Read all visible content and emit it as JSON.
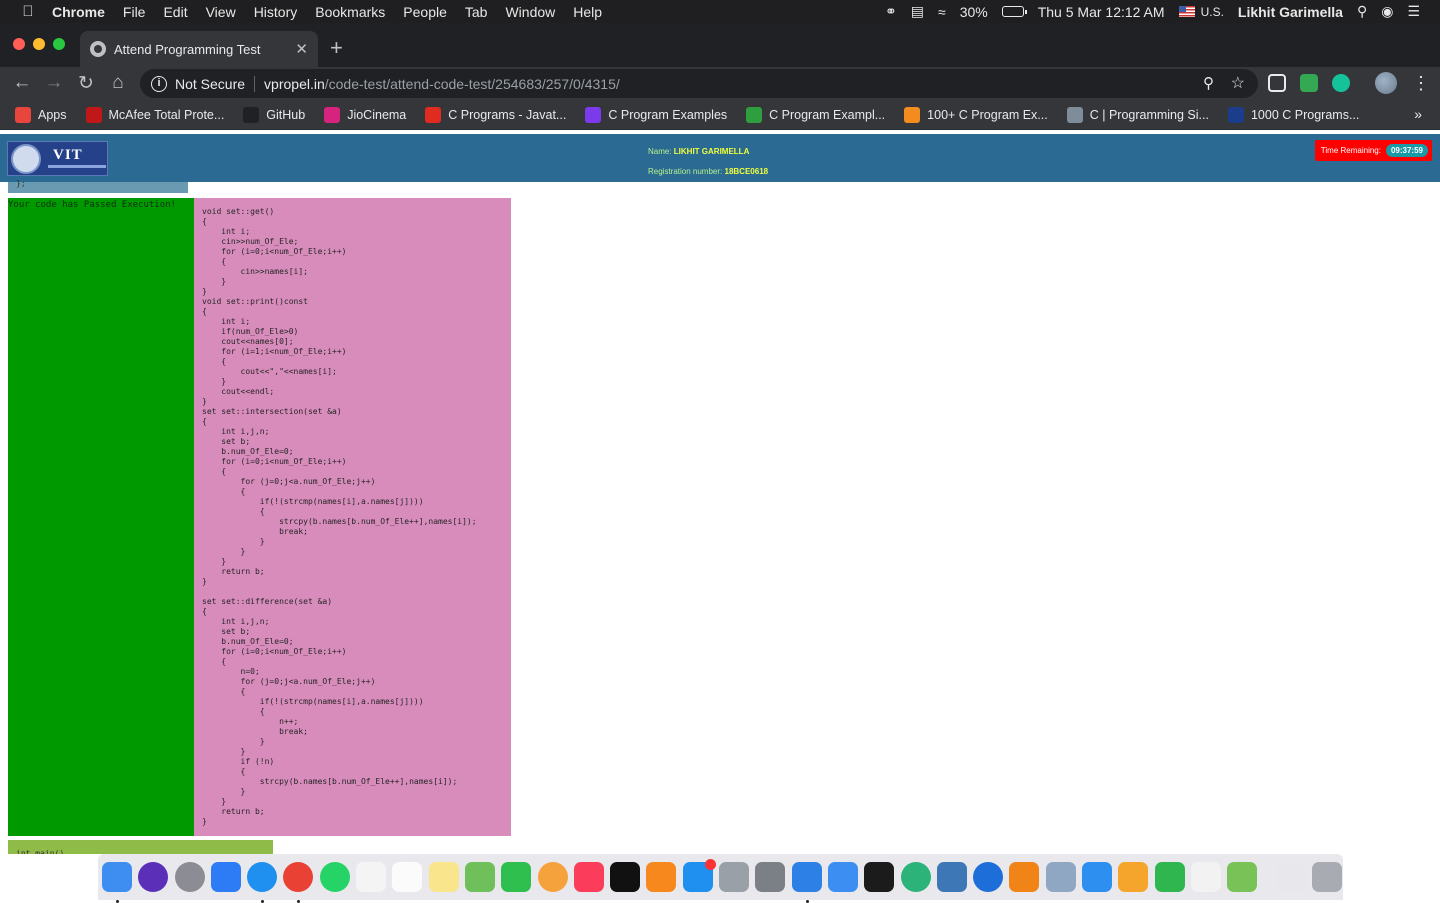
{
  "menubar": {
    "app_name": "Chrome",
    "menus": [
      "File",
      "Edit",
      "View",
      "History",
      "Bookmarks",
      "People",
      "Tab",
      "Window",
      "Help"
    ],
    "battery": "30%",
    "datetime": "Thu 5 Mar  12:12 AM",
    "input_source": "U.S.",
    "user": "Likhit Garimella"
  },
  "tab": {
    "title": "Attend Programming Test",
    "close": "✕",
    "new_tab": "+"
  },
  "toolbar": {
    "security": "Not Secure",
    "url_host": "vpropel.in",
    "url_path": "/code-test/attend-code-test/254683/257/0/4315/"
  },
  "bookmarks": [
    {
      "label": "Apps",
      "color": "#e8453c"
    },
    {
      "label": "McAfee Total Prote...",
      "color": "#c01818"
    },
    {
      "label": "GitHub",
      "color": "#202124"
    },
    {
      "label": "JioCinema",
      "color": "#d6247e"
    },
    {
      "label": "C Programs - Javat...",
      "color": "#e02b20"
    },
    {
      "label": "C Program Examples",
      "color": "#7c3aed"
    },
    {
      "label": "C Program Exampl...",
      "color": "#2e9e3e"
    },
    {
      "label": "100+ C Program Ex...",
      "color": "#f28c1e"
    },
    {
      "label": "C | Programming Si...",
      "color": "#7f8c9a"
    },
    {
      "label": "1000 C Programs...",
      "color": "#1c3c8c"
    }
  ],
  "page": {
    "logo_text": "VIT",
    "name_label": "Name:",
    "name_value": "LIKHIT GARIMELLA",
    "reg_label": "Registration number:",
    "reg_value": "18BCE0618",
    "timer_label": "Time Remaining:",
    "timer_value": "09:37:59",
    "prev_snippet": "};",
    "status": "Your code has Passed Execution!",
    "code": "void set::get()\n{\n    int i;\n    cin>>num_Of_Ele;\n    for (i=0;i<num_Of_Ele;i++)\n    {\n        cin>>names[i];\n    }\n}\nvoid set::print()const\n{\n    int i;\n    if(num_Of_Ele>0)\n    cout<<names[0];\n    for (i=1;i<num_Of_Ele;i++)\n    {\n        cout<<\",\"<<names[i];\n    }\n    cout<<endl;\n}\nset set::intersection(set &a)\n{\n    int i,j,n;\n    set b;\n    b.num_Of_Ele=0;\n    for (i=0;i<num_Of_Ele;i++)\n    {\n        for (j=0;j<a.num_Of_Ele;j++)\n        {\n            if(!(strcmp(names[i],a.names[j])))\n            {\n                strcpy(b.names[b.num_Of_Ele++],names[i]);\n                break;\n            }\n        }\n    }\n    return b;\n}\n\nset set::difference(set &a)\n{\n    int i,j,n;\n    set b;\n    b.num_Of_Ele=0;\n    for (i=0;i<num_Of_Ele;i++)\n    {\n        n=0;\n        for (j=0;j<a.num_Of_Ele;j++)\n        {\n            if(!(strcmp(names[i],a.names[j])))\n            {\n                n++;\n                break;\n            }\n        }\n        if (!n)\n        {\n            strcpy(b.names[b.num_Of_Ele++],names[i]);\n        }\n    }\n    return b;\n}",
    "next_snippet": "int main()"
  },
  "dock": [
    {
      "name": "finder-icon",
      "color": "#3d8ef0",
      "running": true
    },
    {
      "name": "siri-icon",
      "color": "#5b2fb8",
      "round": true
    },
    {
      "name": "launchpad-icon",
      "color": "#8c8c94",
      "round": true
    },
    {
      "name": "bluetooth-icon",
      "color": "#2d7cf6"
    },
    {
      "name": "safari-icon",
      "color": "#1f8ff0",
      "round": true,
      "running": true
    },
    {
      "name": "chrome-icon",
      "color": "#e94235",
      "round": true,
      "running": true
    },
    {
      "name": "whatsapp-icon",
      "color": "#25d366",
      "round": true
    },
    {
      "name": "calendar-icon",
      "color": "#f4f4f4"
    },
    {
      "name": "reminders-icon",
      "color": "#fbfbfb"
    },
    {
      "name": "notes-icon",
      "color": "#f8e58c"
    },
    {
      "name": "maps-icon",
      "color": "#6fbf5b"
    },
    {
      "name": "facetime-icon",
      "color": "#2fbf4f"
    },
    {
      "name": "photos-icon",
      "color": "#f6a23c",
      "round": true
    },
    {
      "name": "music-icon",
      "color": "#fb3c5a"
    },
    {
      "name": "tv-icon",
      "color": "#111111"
    },
    {
      "name": "books-icon",
      "color": "#f7881e"
    },
    {
      "name": "app-store-icon",
      "color": "#1f8ff0",
      "badge": true
    },
    {
      "name": "network-utility-icon",
      "color": "#9aa0a8"
    },
    {
      "name": "system-preferences-icon",
      "color": "#7b7f86"
    },
    {
      "name": "xcode-icon",
      "color": "#2d80e6",
      "running": true
    },
    {
      "name": "instruments-icon",
      "color": "#3c8ef3"
    },
    {
      "name": "terminal-icon",
      "color": "#1b1b1b"
    },
    {
      "name": "atom-icon",
      "color": "#2bb37a",
      "round": true
    },
    {
      "name": "python-launcher-icon",
      "color": "#3d77b6"
    },
    {
      "name": "edge-icon",
      "color": "#1d6ed8",
      "round": true
    },
    {
      "name": "vlc-icon",
      "color": "#f08417"
    },
    {
      "name": "image-capture-icon",
      "color": "#8fa7c2"
    },
    {
      "name": "keynote-icon",
      "color": "#2d8ff0"
    },
    {
      "name": "pages-icon",
      "color": "#f5a52b"
    },
    {
      "name": "numbers-icon",
      "color": "#2fb64f"
    },
    {
      "name": "textedit-icon",
      "color": "#f2f2f2"
    },
    {
      "name": "android-studio-icon",
      "color": "#78c257"
    },
    {
      "name": "documents-folder-icon",
      "color": "#e8e8ec"
    },
    {
      "name": "trash-icon",
      "color": "#a9abb2"
    }
  ]
}
